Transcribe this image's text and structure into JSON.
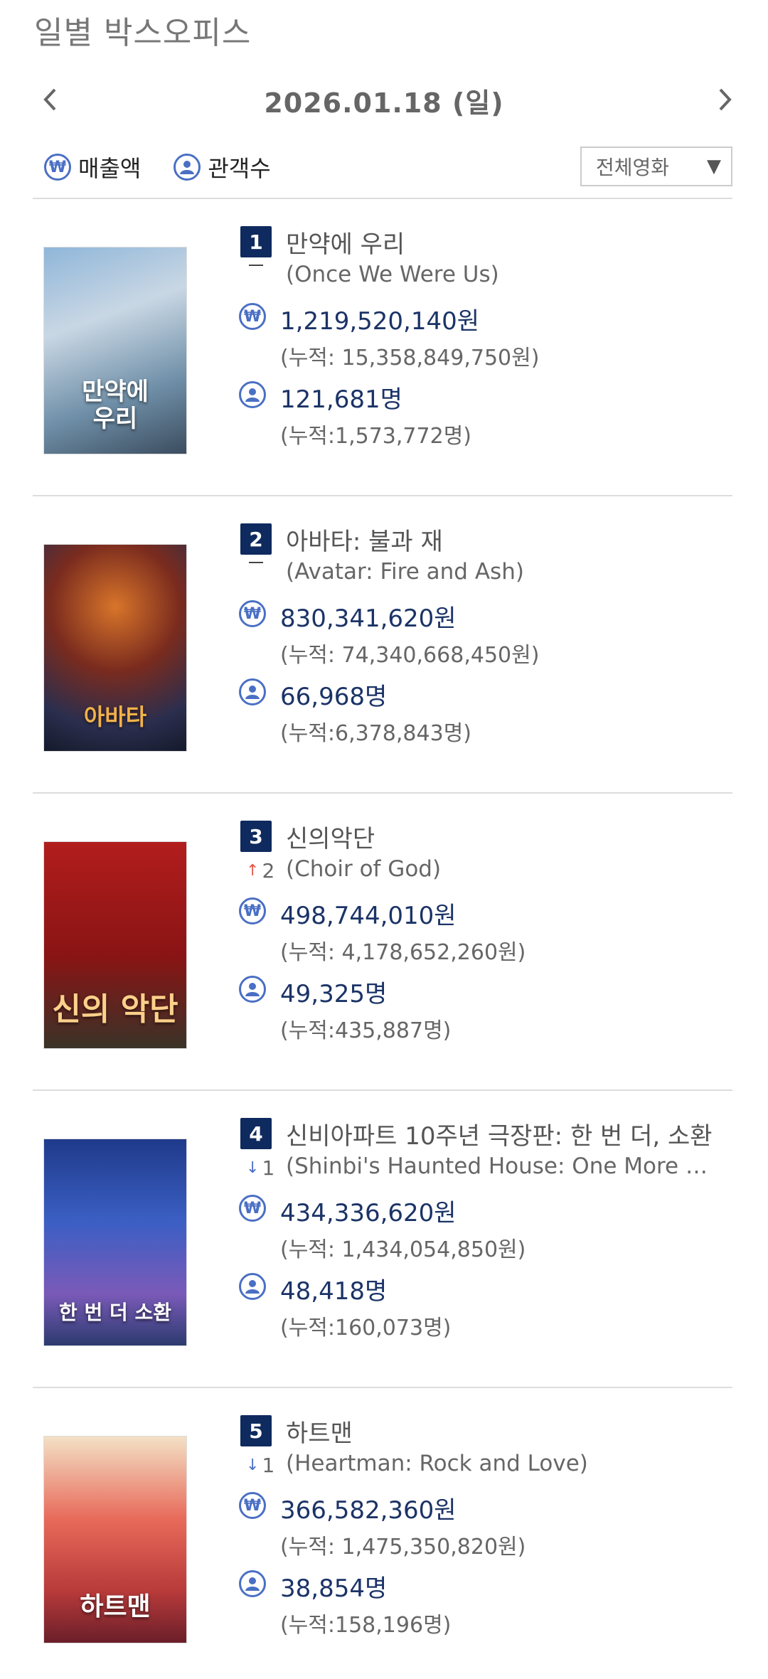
{
  "page_title": "일별 박스오피스",
  "date": "2026.01.18 (일)",
  "legend": {
    "sales_label": "매출액",
    "audience_label": "관객수",
    "sales_icon": "won-icon",
    "audience_icon": "person-icon"
  },
  "filter": {
    "selected": "전체영화"
  },
  "colors": {
    "badge": "#0f2a5e",
    "accent": "#4a6fc4",
    "value_text": "#1b3367",
    "up": "#e0584a",
    "down": "#4a6fc4"
  },
  "movies": [
    {
      "rank": "1",
      "title_ko": "만약에 우리",
      "change": "",
      "change_dir": "none",
      "title_en": "(Once We Were Us)",
      "sales": "1,219,520,140원",
      "sales_cum": "(누적: 15,358,849,750원)",
      "audience": "121,681명",
      "audience_cum": "(누적:1,573,772명)",
      "poster_text": "만약에\n우리"
    },
    {
      "rank": "2",
      "title_ko": "아바타: 불과 재",
      "change": "",
      "change_dir": "none",
      "title_en": "(Avatar: Fire and Ash)",
      "sales": "830,341,620원",
      "sales_cum": "(누적: 74,340,668,450원)",
      "audience": "66,968명",
      "audience_cum": "(누적:6,378,843명)",
      "poster_text": "아바타"
    },
    {
      "rank": "3",
      "title_ko": "신의악단",
      "change": "2",
      "change_dir": "up",
      "title_en": "(Choir of God)",
      "sales": "498,744,010원",
      "sales_cum": "(누적: 4,178,652,260원)",
      "audience": "49,325명",
      "audience_cum": "(누적:435,887명)",
      "poster_text": "신의 악단"
    },
    {
      "rank": "4",
      "title_ko": "신비아파트 10주년 극장판: 한 번 더, 소환",
      "change": "1",
      "change_dir": "down",
      "title_en": "(Shinbi's Haunted House: One More Summ...",
      "sales": "434,336,620원",
      "sales_cum": "(누적: 1,434,054,850원)",
      "audience": "48,418명",
      "audience_cum": "(누적:160,073명)",
      "poster_text": "한 번 더 소환"
    },
    {
      "rank": "5",
      "title_ko": "하트맨",
      "change": "1",
      "change_dir": "down",
      "title_en": "(Heartman: Rock and Love)",
      "sales": "366,582,360원",
      "sales_cum": "(누적: 1,475,350,820원)",
      "audience": "38,854명",
      "audience_cum": "(누적:158,196명)",
      "poster_text": "하트맨"
    }
  ]
}
